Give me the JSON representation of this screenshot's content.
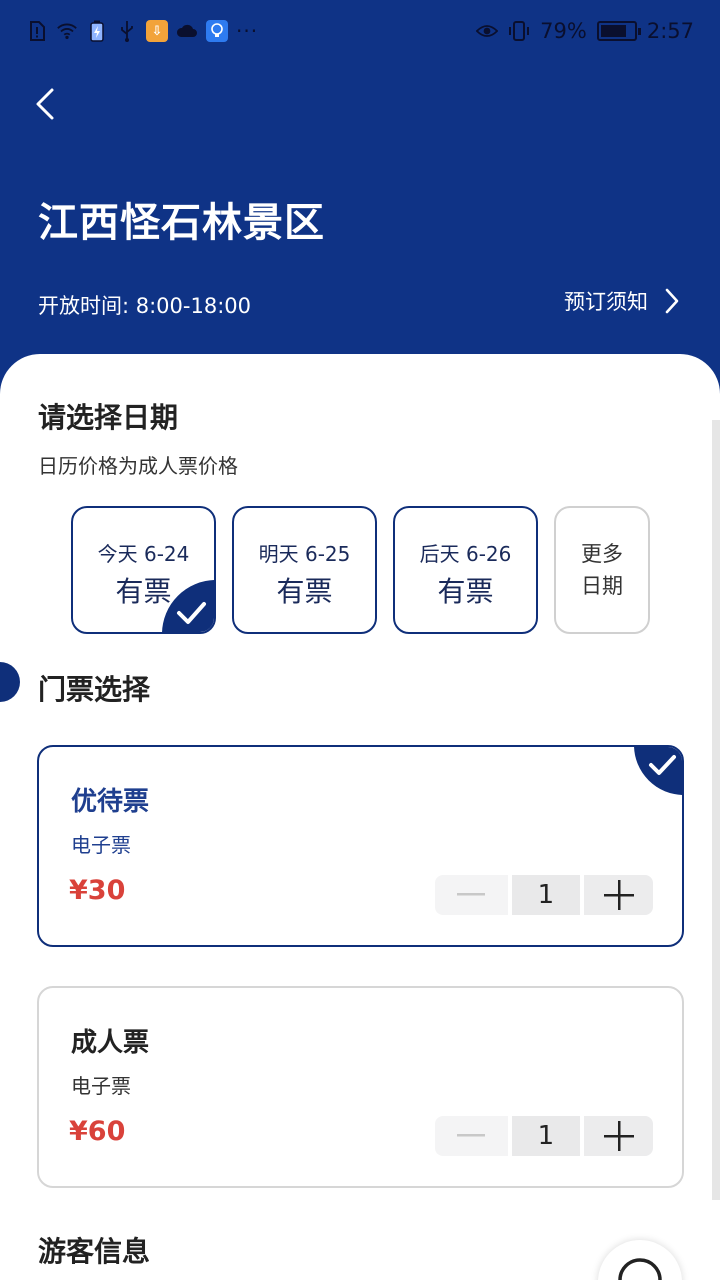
{
  "status_bar": {
    "battery_percent": "79%",
    "battery_level": 0.79,
    "time": "2:57",
    "icons": [
      "alert-icon",
      "wifi-icon",
      "charging-icon",
      "usb-icon",
      "app-notification-icon",
      "cloud-icon",
      "bulb-app-icon",
      "more-dots-icon",
      "eye-icon",
      "vibrate-icon",
      "battery-icon"
    ],
    "more_dots": "···"
  },
  "header": {
    "title": "江西怪石林景区",
    "open_hours": "开放时间: 8:00-18:00",
    "booking_notice": "预订须知",
    "background": "#0f3386"
  },
  "date_section": {
    "title": "请选择日期",
    "subtitle": "日历价格为成人票价格",
    "dates": [
      {
        "label": "今天 6-24",
        "status": "有票",
        "selected": true
      },
      {
        "label": "明天 6-25",
        "status": "有票",
        "selected": false
      },
      {
        "label": "后天 6-26",
        "status": "有票",
        "selected": false
      }
    ],
    "more": {
      "line1": "更多",
      "line2": "日期"
    }
  },
  "ticket_section": {
    "title": "门票选择",
    "tickets": [
      {
        "name": "优待票",
        "type": "电子票",
        "price": "¥30",
        "quantity": "1",
        "selected": true
      },
      {
        "name": "成人票",
        "type": "电子票",
        "price": "¥60",
        "quantity": "1",
        "selected": false
      }
    ]
  },
  "visitor_section": {
    "title": "游客信息"
  },
  "colors": {
    "primary": "#0f2f7a",
    "price": "#d9423a",
    "selected_text": "#1f3f8f"
  }
}
